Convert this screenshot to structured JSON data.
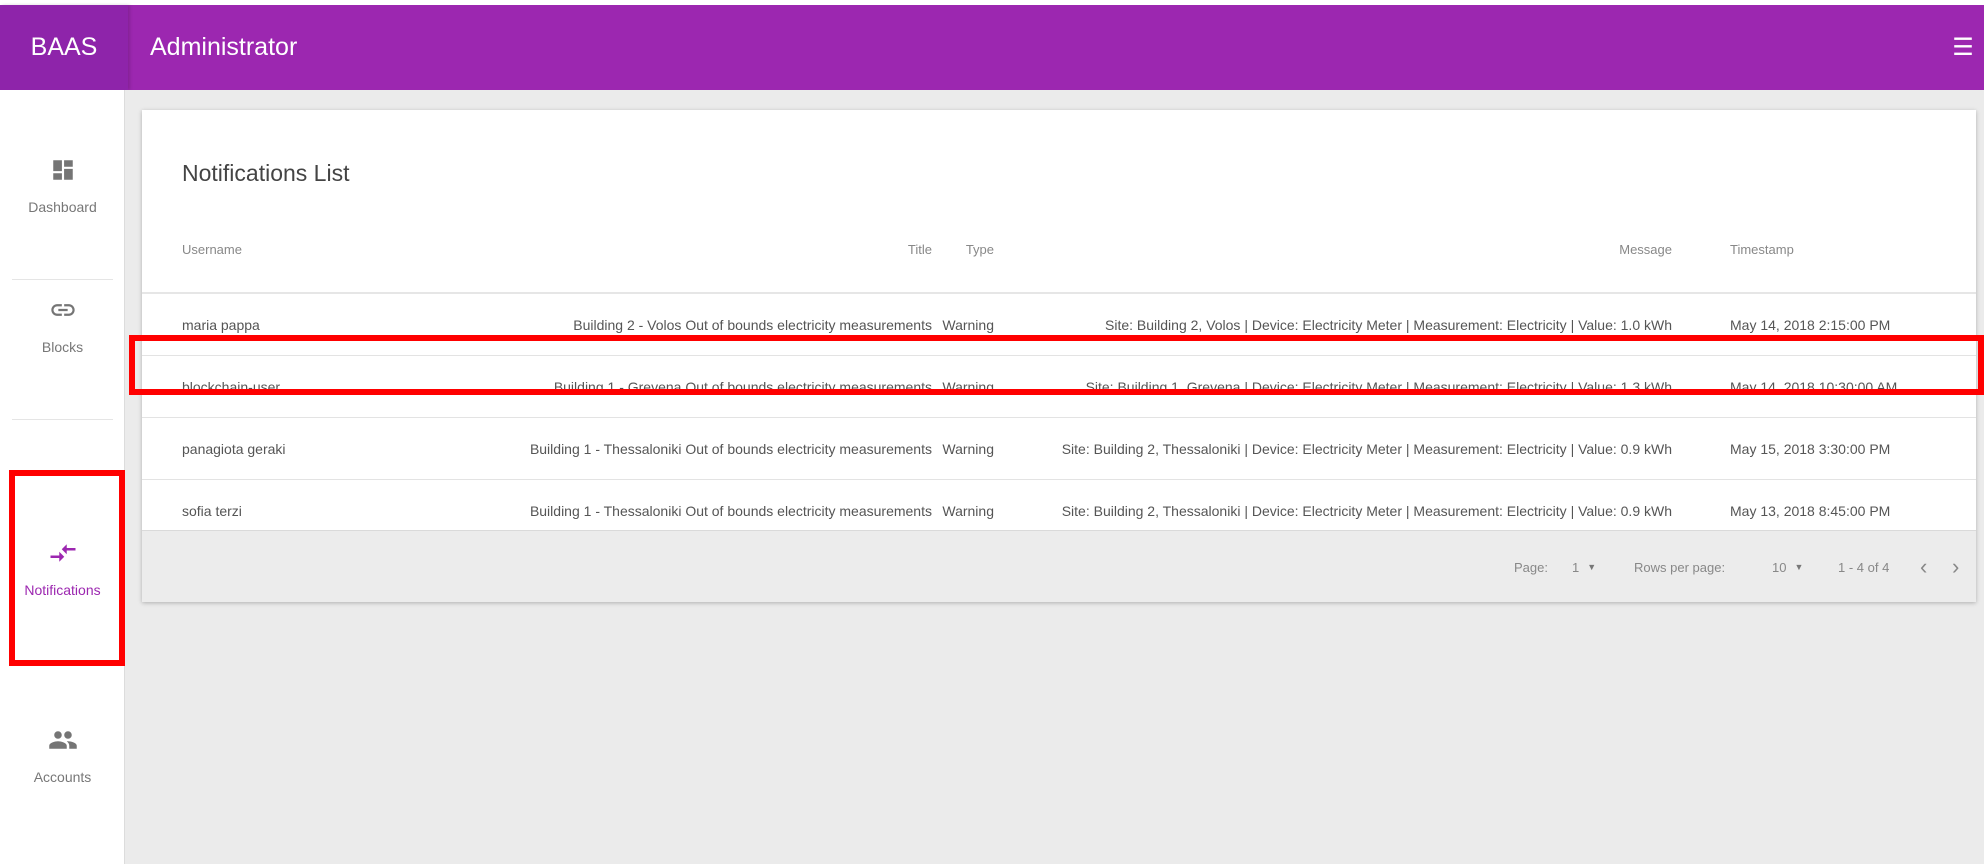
{
  "brand": "BAAS",
  "appbar": {
    "title": "Administrator",
    "menu_icon": "☰"
  },
  "sidebar": {
    "items": [
      {
        "label": "Dashboard",
        "icon": "dashboard-icon"
      },
      {
        "label": "Blocks",
        "icon": "link-icon"
      },
      {
        "label": "Notifications",
        "icon": "compare-arrows-icon",
        "active": true
      },
      {
        "label": "Accounts",
        "icon": "people-icon"
      }
    ]
  },
  "notifications": {
    "title": "Notifications List",
    "columns": {
      "username": "Username",
      "title": "Title",
      "type": "Type",
      "message": "Message",
      "timestamp": "Timestamp"
    },
    "rows": [
      {
        "username": "maria pappa",
        "title": "Building 2 - Volos Out of bounds electricity measurements",
        "type": "Warning",
        "message": "Site: Building 2, Volos | Device: Electricity Meter | Measurement: Electricity | Value: 1.0 kWh",
        "timestamp": "May 14, 2018 2:15:00 PM"
      },
      {
        "username": "blockchain-user",
        "title": "Building 1 - Grevena Out of bounds electricity measurements",
        "type": "Warning",
        "message": "Site: Building 1, Grevena | Device: Electricity Meter | Measurement: Electricity | Value: 1.3 kWh",
        "timestamp": "May 14, 2018 10:30:00 AM"
      },
      {
        "username": "panagiota geraki",
        "title": "Building 1 - Thessaloniki Out of bounds electricity measurements",
        "type": "Warning",
        "message": "Site: Building 2, Thessaloniki | Device: Electricity Meter | Measurement: Electricity | Value: 0.9 kWh",
        "timestamp": "May 15, 2018 3:30:00 PM"
      },
      {
        "username": "sofia terzi",
        "title": "Building 1 - Thessaloniki Out of bounds electricity measurements",
        "type": "Warning",
        "message": "Site: Building 2, Thessaloniki | Device: Electricity Meter | Measurement: Electricity | Value: 0.9 kWh",
        "timestamp": "May 13, 2018 8:45:00 PM"
      }
    ],
    "pagination": {
      "page_label": "Page:",
      "page_value": "1",
      "rows_label": "Rows per page:",
      "rows_value": "10",
      "range": "1 - 4 of 4",
      "prev": "‹",
      "next": "›"
    }
  },
  "colors": {
    "primary": "#9c27b0",
    "primary_dark": "#8e24aa",
    "highlight": "#ff0000",
    "background": "#ebebeb"
  }
}
